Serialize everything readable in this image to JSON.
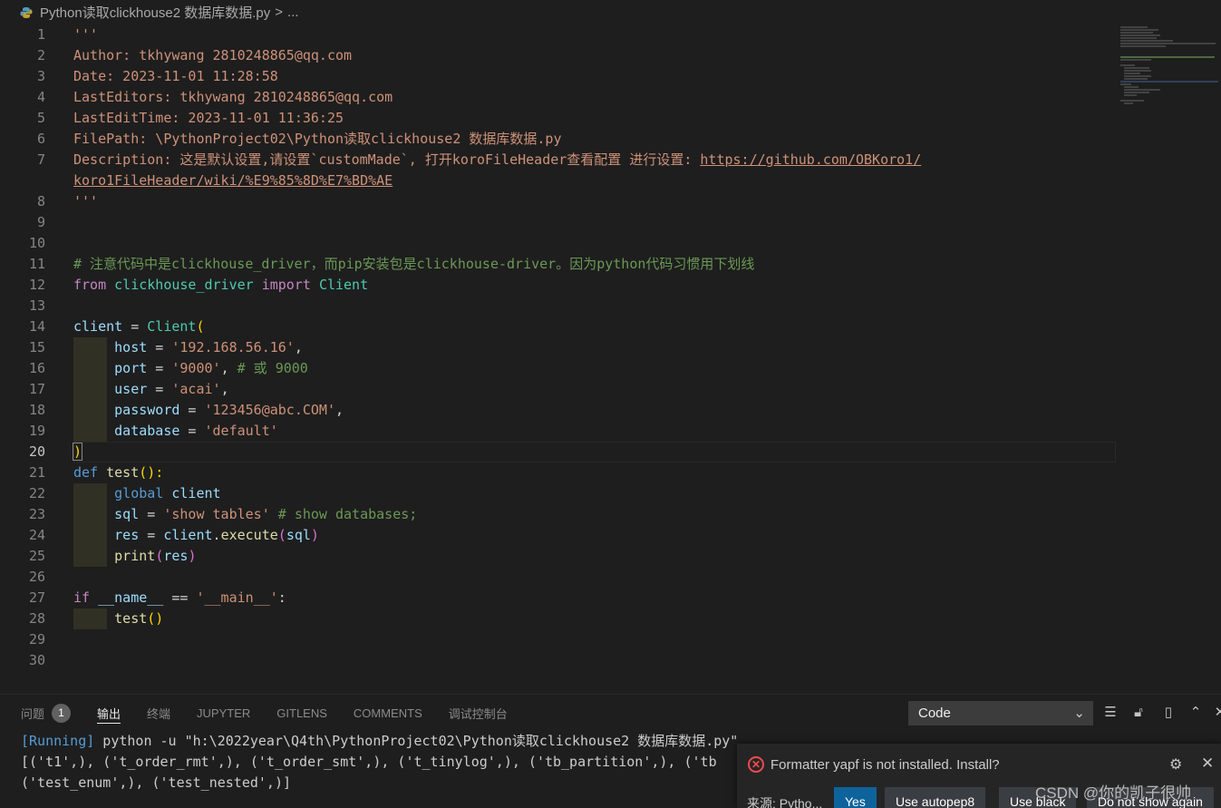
{
  "breadcrumb": {
    "file": "Python读取clickhouse2 数据库数据.py",
    "sep": ">",
    "more": "..."
  },
  "editor": {
    "line_numbers": [
      "1",
      "2",
      "3",
      "4",
      "5",
      "6",
      "7",
      "",
      "8",
      "9",
      "10",
      "11",
      "12",
      "13",
      "14",
      "15",
      "16",
      "17",
      "18",
      "19",
      "20",
      "21",
      "22",
      "23",
      "24",
      "25",
      "26",
      "27",
      "28",
      "29",
      "30"
    ],
    "header": {
      "open": "'''",
      "author": "Author: tkhywang 2810248865@qq.com",
      "date": "Date: 2023-11-01 11:28:58",
      "last_editors": "LastEditors: tkhywang 2810248865@qq.com",
      "last_edit_time": "LastEditTime: 2023-11-01 11:36:25",
      "file_path": "FilePath: \\PythonProject02\\Python读取clickhouse2 数据库数据.py",
      "description": "Description: 这是默认设置,请设置`customMade`, 打开koroFileHeader查看配置 进行设置: ",
      "link_a": "https://github.com/OBKoro1/",
      "link_b": "koro1FileHeader/wiki/%E9%85%8D%E7%BD%AE",
      "close": "'''"
    },
    "comment_line": "# 注意代码中是clickhouse_driver，而pip安装包是clickhouse-driver。因为python代码习惯用下划线",
    "import": {
      "from": "from",
      "module": "clickhouse_driver",
      "import": "import",
      "name": "Client"
    },
    "client": {
      "var": "client",
      "eq": " = ",
      "cls": "Client",
      "open": "(",
      "host_k": "host",
      "host_v": "'192.168.56.16'",
      "port_k": "port",
      "port_v": "'9000'",
      "port_c": "# 或 9000",
      "user_k": "user",
      "user_v": "'acai'",
      "pass_k": "password",
      "pass_v": "'123456@abc.COM'",
      "db_k": "database",
      "db_v": "'default'",
      "close": ")"
    },
    "func": {
      "def": "def",
      "name": "test",
      "sig": "():",
      "global": "global",
      "client": "client",
      "sql": "sql",
      "sql_v": "'show tables'",
      "sql_c": "# show databases;",
      "res": "res",
      "exec_obj": "client",
      "exec_fn": "execute",
      "exec_arg": "sql",
      "print": "print",
      "print_arg": "res"
    },
    "main": {
      "if": "if",
      "name": "__name__",
      "op": " == ",
      "val": "'__main__'",
      "colon": ":",
      "call": "test",
      "paren": "()"
    }
  },
  "panel": {
    "tabs": [
      "问题",
      "输出",
      "终端",
      "JUPYTER",
      "GITLENS",
      "COMMENTS",
      "调试控制台"
    ],
    "problems_count": "1",
    "source_selected": "Code",
    "output": {
      "running": "[Running]",
      "command": " python -u \"h:\\2022year\\Q4th\\PythonProject02\\Python读取clickhouse2 数据库数据.py\"",
      "line2": "[('t1',), ('t_order_rmt',), ('t_order_smt',), ('t_tinylog',), ('tb_partition',), ('tb",
      "line3": "('test_enum',), ('test_nested',)]"
    }
  },
  "notification": {
    "message": "Formatter yapf is not installed. Install?",
    "source": "来源: Pytho...",
    "buttons": [
      "Yes",
      "Use autopep8",
      "Use black",
      "Do not show again"
    ]
  },
  "watermark": "CSDN @你的凯子很帅",
  "colors": {
    "keyword": "#c586c0",
    "string": "#ce9178",
    "comment": "#6a9955",
    "variable": "#9cdcfe",
    "class": "#4ec9b0",
    "function": "#dcdcaa",
    "primary_button": "#0e639c"
  }
}
